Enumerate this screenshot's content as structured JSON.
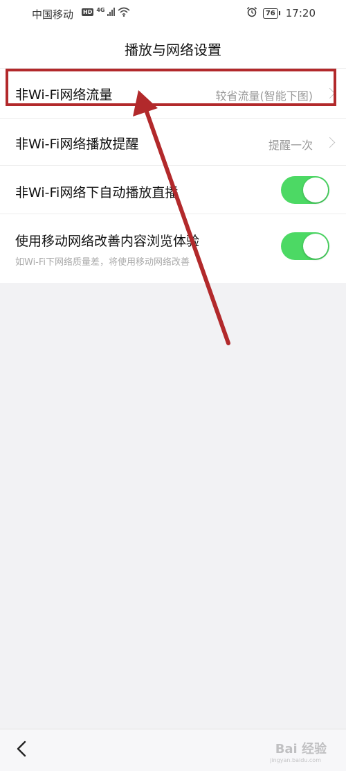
{
  "status_bar": {
    "carrier": "中国移动",
    "hd": "HD",
    "net_type": "4G",
    "battery_level": "76",
    "time": "17:20"
  },
  "header": {
    "title": "播放与网络设置"
  },
  "settings": {
    "non_wifi_traffic": {
      "label": "非Wi-Fi网络流量",
      "value": "较省流量(智能下图)"
    },
    "non_wifi_play_reminder": {
      "label": "非Wi-Fi网络播放提醒",
      "value": "提醒一次"
    },
    "non_wifi_autoplay_live": {
      "label": "非Wi-Fi网络下自动播放直播",
      "enabled": true
    },
    "mobile_network_improve": {
      "label": "使用移动网络改善内容浏览体验",
      "description": "如Wi-Fi下网络质量差，将使用移动网络改善",
      "enabled": true
    }
  },
  "watermark": {
    "text": "Bai 经验",
    "sub": "jingyan.baidu.com"
  },
  "colors": {
    "toggle_on": "#4cd964",
    "annotation_red": "#b2292b",
    "background": "#f2f2f4"
  },
  "icons": {
    "alarm": "alarm-icon",
    "wifi": "wifi-icon",
    "back": "back-arrow-icon",
    "chevron": "chevron-right-icon"
  }
}
